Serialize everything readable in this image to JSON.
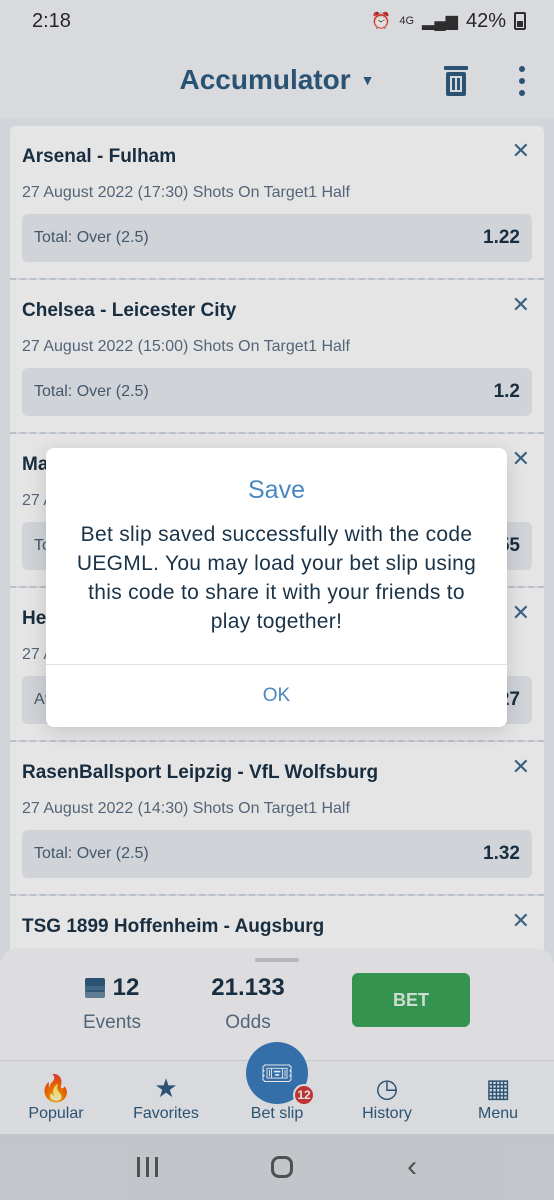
{
  "status": {
    "time": "2:18",
    "network": "4G",
    "battery": "42%"
  },
  "header": {
    "title": "Accumulator"
  },
  "bets": [
    {
      "match": "Arsenal - Fulham",
      "info": "27 August 2022 (17:30) Shots On Target1 Half",
      "market": "Total: Over (2.5)",
      "odd": "1.22"
    },
    {
      "match": "Chelsea - Leicester City",
      "info": "27 August 2022 (15:00) Shots On Target1 Half",
      "market": "Total: Over (2.5)",
      "odd": "1.2"
    },
    {
      "match": "Ma",
      "info": "27 A",
      "market": "To",
      "odd": "55"
    },
    {
      "match": "He",
      "info": "27 A",
      "market": "At",
      "odd": "27"
    },
    {
      "match": "RasenBallsport Leipzig - VfL Wolfsburg",
      "info": "27 August 2022 (14:30) Shots On Target1 Half",
      "market": "Total: Over (2.5)",
      "odd": "1.32"
    },
    {
      "match": "TSG 1899 Hoffenheim - Augsburg",
      "info": "",
      "market": "",
      "odd": ""
    }
  ],
  "summary": {
    "events_count": "12",
    "events_label": "Events",
    "odds_value": "21.133",
    "odds_label": "Odds",
    "bet_label": "BET"
  },
  "tabs": {
    "popular": "Popular",
    "favorites": "Favorites",
    "betslip": "Bet slip",
    "betslip_badge": "12",
    "history": "History",
    "menu": "Menu"
  },
  "dialog": {
    "title": "Save",
    "message": "Bet slip saved successfully with the code UEGML. You may load your bet slip using this code to share it with your friends to play together!",
    "ok_label": "OK"
  },
  "colors": {
    "accent": "#2f5c80",
    "link": "#4a87c2",
    "bet_button": "#3aa457",
    "badge": "#d43b3b"
  }
}
